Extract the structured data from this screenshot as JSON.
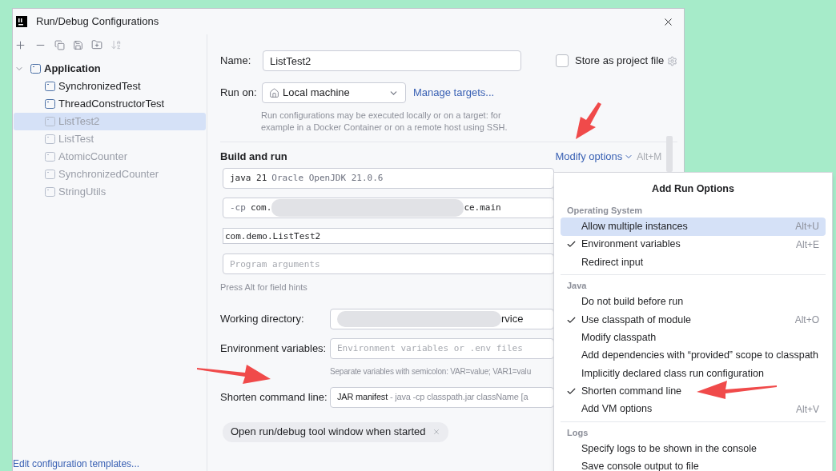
{
  "window": {
    "title": "Run/Debug Configurations"
  },
  "tree": {
    "items": [
      {
        "label": "Application",
        "expanded": true,
        "children": [
          {
            "label": "SynchronizedTest",
            "selected": false,
            "temporary": false
          },
          {
            "label": "ThreadConstructorTest",
            "selected": false,
            "temporary": false
          },
          {
            "label": "ListTest2",
            "selected": true,
            "temporary": true
          },
          {
            "label": "ListTest",
            "selected": false,
            "temporary": true
          },
          {
            "label": "AtomicCounter",
            "selected": false,
            "temporary": true
          },
          {
            "label": "SynchronizedCounter",
            "selected": false,
            "temporary": true
          },
          {
            "label": "StringUtils",
            "selected": false,
            "temporary": true
          }
        ]
      }
    ]
  },
  "footer_link": "Edit configuration templates...",
  "form": {
    "name": {
      "label": "Name:",
      "value": "ListTest2"
    },
    "store_as_project_file": {
      "label": "Store as project file",
      "checked": false
    },
    "run_on": {
      "label": "Run on:",
      "value": "Local machine",
      "link": "Manage targets..."
    },
    "run_on_hint": "Run configurations may be executed locally or on a target: for example in a Docker Container or on a remote host using SSH.",
    "section_title": "Build and run",
    "modify_options": {
      "label": "Modify options",
      "shortcut": "Alt+M"
    },
    "jre_field": {
      "value": "java 21",
      "detail": "Oracle OpenJDK 21.0.6"
    },
    "classpath_field": {
      "prefix": "-cp",
      "value_start": "com.",
      "value_end": "ce.main"
    },
    "main_class_field": {
      "value": "com.demo.ListTest2"
    },
    "program_arguments": {
      "placeholder": "Program arguments"
    },
    "field_hint": "Press Alt for field hints",
    "working_directory": {
      "label": "Working directory:",
      "value_end": "rvice"
    },
    "environment_variables": {
      "label": "Environment variables:",
      "placeholder": "Environment variables or .env files",
      "hint": "Separate variables with semicolon: VAR=value; VAR1=valu"
    },
    "shorten_command_line": {
      "label": "Shorten command line:",
      "value": "JAR manifest",
      "detail": "- java -cp classpath.jar className [a"
    },
    "chip": {
      "label": "Open run/debug tool window when started"
    }
  },
  "menu": {
    "title": "Add Run Options",
    "sections": [
      {
        "title": "Operating System",
        "items": [
          {
            "label": "Allow multiple instances",
            "checked": false,
            "shortcut": "Alt+U",
            "selected": true
          },
          {
            "label": "Environment variables",
            "checked": true,
            "shortcut": "Alt+E",
            "selected": false
          },
          {
            "label": "Redirect input",
            "checked": false,
            "selected": false
          }
        ]
      },
      {
        "title": "Java",
        "items": [
          {
            "label": "Do not build before run",
            "checked": false,
            "selected": false
          },
          {
            "label": "Use classpath of module",
            "checked": true,
            "shortcut": "Alt+O",
            "selected": false
          },
          {
            "label": "Modify classpath",
            "checked": false,
            "selected": false
          },
          {
            "label": "Add dependencies with “provided” scope to classpath",
            "checked": false,
            "selected": false
          },
          {
            "label": "Implicitly declared class run configuration",
            "checked": false,
            "selected": false
          },
          {
            "label": "Shorten command line",
            "checked": true,
            "selected": false
          },
          {
            "label": "Add VM options",
            "checked": false,
            "shortcut": "Alt+V",
            "selected": false
          }
        ]
      },
      {
        "title": "Logs",
        "items": [
          {
            "label": "Specify logs to be shown in the console",
            "checked": false,
            "selected": false
          },
          {
            "label": "Save console output to file",
            "checked": false,
            "selected": false
          }
        ]
      }
    ]
  }
}
